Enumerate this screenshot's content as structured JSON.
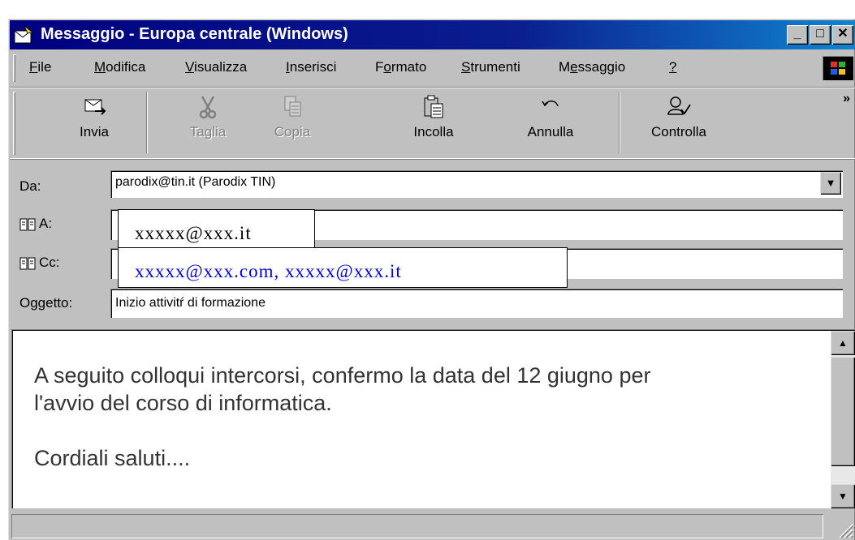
{
  "window": {
    "title": "Messaggio - Europa centrale (Windows)",
    "controls": [
      "_",
      "□",
      "✕"
    ]
  },
  "menu": [
    {
      "label": "File",
      "hotkey": "F",
      "rest": "ile"
    },
    {
      "label": "Modifica",
      "hotkey": "M",
      "rest": "odifica"
    },
    {
      "label": "Visualizza",
      "hotkey": "V",
      "rest": "isualizza"
    },
    {
      "label": "Inserisci",
      "hotkey": "I",
      "rest": "nserisci"
    },
    {
      "label": "Formato",
      "pre": "F",
      "hotkey": "o",
      "rest": "rmato"
    },
    {
      "label": "Strumenti",
      "hotkey": "S",
      "rest": "trumenti"
    },
    {
      "label": "Messaggio",
      "pre": "M",
      "hotkey": "e",
      "rest": "ssaggio"
    },
    {
      "label": "?",
      "hotkey": "?",
      "rest": ""
    }
  ],
  "toolbar": {
    "send": "Invia",
    "cut": "Taglia",
    "copy": "Copia",
    "paste": "Incolla",
    "undo": "Annulla",
    "check": "Controlla",
    "more": "»"
  },
  "header": {
    "from_label": "Da:",
    "from_value": "parodix@tin.it    (Parodix TIN)",
    "to_label": "A:",
    "to_value": "xxxxx@xxx.it",
    "cc_label": "Cc:",
    "cc_value": "xxxxx@xxx.com, xxxxx@xxx.it",
    "subject_label": "Oggetto:",
    "subject_value": "Inizio attivitŕ di formazione"
  },
  "body": {
    "line1": "A seguito colloqui intercorsi, confermo la data del 12 giugno per",
    "line2": "l'avvio del corso di informatica.",
    "line3": "Cordiali saluti...."
  },
  "colors": {
    "titlebar_start": "#000080",
    "titlebar_end": "#1084d0",
    "face": "#c0c0c0",
    "cc_text": "#0000ee"
  }
}
